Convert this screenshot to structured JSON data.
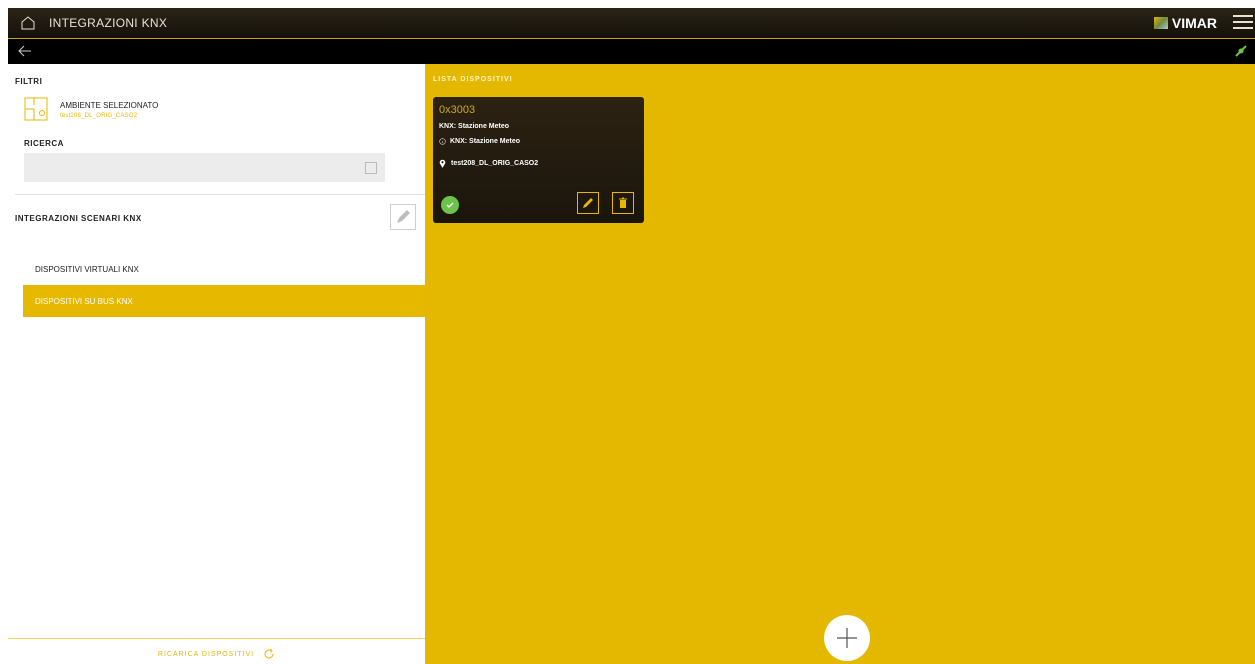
{
  "header": {
    "title": "INTEGRAZIONI KNX",
    "brand": "VIMAR",
    "icons": {
      "home": "home-icon",
      "menu": "hamburger-menu-icon",
      "back": "back-arrow-icon",
      "connection": "connection-status-icon"
    }
  },
  "left_panel": {
    "filters_label": "FILTRI",
    "environment": {
      "title": "AMBIENTE SELEZIONATO",
      "value": "test208_DL_ORIG_CASO2"
    },
    "search": {
      "label": "RICERCA",
      "value": "",
      "placeholder": ""
    },
    "scenarios_label": "INTEGRAZIONI SCENARI KNX",
    "nav": [
      {
        "label": "DISPOSITIVI VIRTUALI KNX",
        "active": false
      },
      {
        "label": "DISPOSITIVI SU BUS KNX",
        "active": true
      }
    ],
    "reload_label": "RICARICA DISPOSITIVI"
  },
  "device_list": {
    "label": "LISTA DISPOSITIVI",
    "devices": [
      {
        "address": "0x3003",
        "name": "KNX: Stazione Meteo",
        "type": "KNX: Stazione Meteo",
        "location": "test208_DL_ORIG_CASO2",
        "status": "ok"
      }
    ]
  },
  "colors": {
    "accent": "#e6b800",
    "topbar": "#1c170f",
    "card": "#231b10",
    "status_ok": "#6cc24a"
  }
}
